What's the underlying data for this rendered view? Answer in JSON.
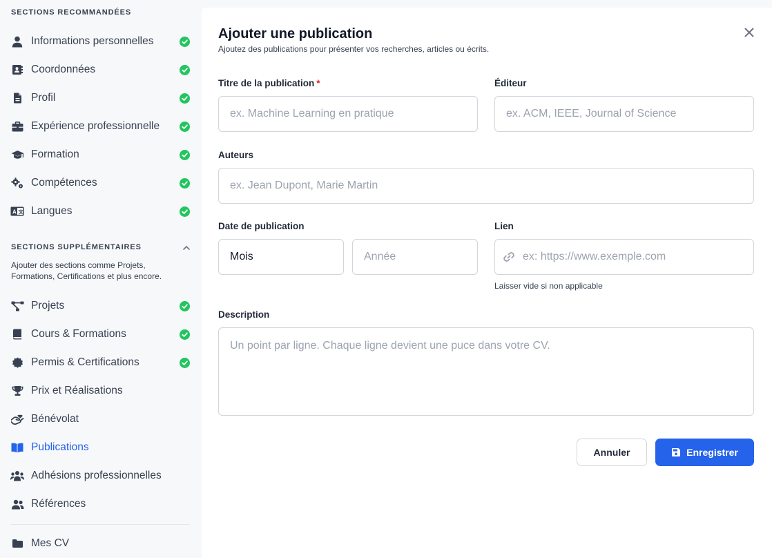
{
  "sidebar": {
    "recommended_heading": "SECTIONS RECOMMANDÉES",
    "recommended": [
      {
        "label": "Informations personnelles",
        "icon": "user-icon",
        "done": true
      },
      {
        "label": "Coordonnées",
        "icon": "contact-book-icon",
        "done": true
      },
      {
        "label": "Profil",
        "icon": "document-icon",
        "done": true
      },
      {
        "label": "Expérience professionnelle",
        "icon": "briefcase-icon",
        "done": true
      },
      {
        "label": "Formation",
        "icon": "graduation-cap-icon",
        "done": true
      },
      {
        "label": "Compétences",
        "icon": "gears-icon",
        "done": true
      },
      {
        "label": "Langues",
        "icon": "language-icon",
        "done": true
      }
    ],
    "supplementary_heading": "SECTIONS SUPPLÉMENTAIRES",
    "supplementary_description": "Ajouter des sections comme Projets, Formations, Certifications et plus encore.",
    "supplementary": [
      {
        "label": "Projets",
        "icon": "project-diagram-icon",
        "done": true
      },
      {
        "label": "Cours & Formations",
        "icon": "book-icon",
        "done": true
      },
      {
        "label": "Permis & Certifications",
        "icon": "certificate-icon",
        "done": true
      },
      {
        "label": "Prix et Réalisations",
        "icon": "trophy-icon",
        "done": false
      },
      {
        "label": "Bénévolat",
        "icon": "helping-hands-icon",
        "done": false
      },
      {
        "label": "Publications",
        "icon": "open-book-icon",
        "done": false,
        "active": true
      },
      {
        "label": "Adhésions professionnelles",
        "icon": "users-group-icon",
        "done": false
      },
      {
        "label": "Références",
        "icon": "users-icon",
        "done": false
      }
    ],
    "footer_item": {
      "label": "Mes CV",
      "icon": "folder-icon"
    }
  },
  "form": {
    "title": "Ajouter une publication",
    "subtitle": "Ajoutez des publications pour présenter vos recherches, articles ou écrits.",
    "title_label": "Titre de la publication",
    "required_mark": "*",
    "title_placeholder": "ex. Machine Learning en pratique",
    "publisher_label": "Éditeur",
    "publisher_placeholder": "ex. ACM, IEEE, Journal of Science",
    "authors_label": "Auteurs",
    "authors_placeholder": "ex. Jean Dupont, Marie Martin",
    "date_label": "Date de publication",
    "month_value": "Mois",
    "year_placeholder": "Année",
    "link_label": "Lien",
    "link_placeholder": "ex: https://www.exemple.com",
    "link_hint": "Laisser vide si non applicable",
    "description_label": "Description",
    "description_placeholder": "Un point par ligne. Chaque ligne devient une puce dans votre CV.",
    "cancel_label": "Annuler",
    "save_label": "Enregistrer"
  },
  "colors": {
    "accent": "#2563eb",
    "check": "#22c55e",
    "required": "#dc2626"
  }
}
